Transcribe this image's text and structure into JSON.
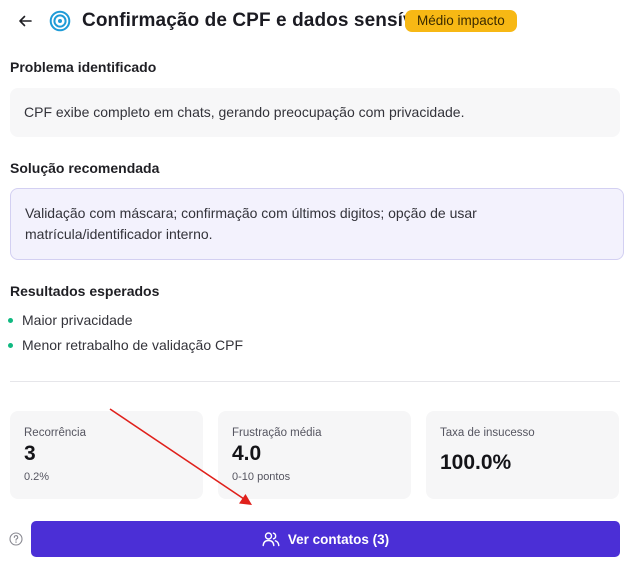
{
  "header": {
    "title": "Confirmação de CPF e dados sensíveis",
    "badge": "Médio impacto",
    "badge_color": "#f7b814"
  },
  "problem": {
    "heading": "Problema identificado",
    "text": "CPF exibe completo em chats, gerando preocupação com privacidade."
  },
  "solution": {
    "heading": "Solução recomendada",
    "text": "Validação com máscara; confirmação com últimos digitos; opção de usar matrícula/identificador interno."
  },
  "results": {
    "heading": "Resultados esperados",
    "items": [
      "Maior privacidade",
      "Menor retrabalho de validação CPF"
    ],
    "bullet_color": "#10b981"
  },
  "metrics": [
    {
      "label": "Recorrência",
      "value": "3",
      "sub": "0.2%"
    },
    {
      "label": "Frustração média",
      "value": "4.0",
      "sub": "0-10 pontos"
    },
    {
      "label": "Taxa de insucesso",
      "value": "100.0%",
      "sub": ""
    }
  ],
  "cta": {
    "label": "Ver contatos (3)",
    "color": "#4b2fd6"
  },
  "icons": {
    "back": "arrow-left-icon",
    "target": "target-icon",
    "help": "help-circle-icon",
    "users": "users-icon"
  },
  "annotation_color": "#e0201b"
}
